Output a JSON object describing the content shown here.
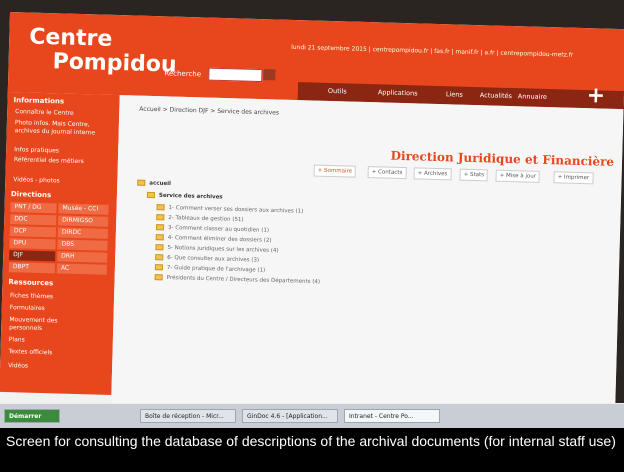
{
  "header": {
    "logo_line1": "Centre",
    "logo_line2": "Pompidou",
    "search_label": "Recherche",
    "date_bar": "lundi 21 septembre 2015 | centrepompidou.fr | fas.fr | manif.fr | a.fr | centrepompidou-metz.fr",
    "nav": [
      "Outils",
      "Applications",
      "Liens",
      "Annuaire",
      "Actualités"
    ]
  },
  "sidebar": {
    "informations_heading": "Informations",
    "info_items": [
      "Connaître le Centre",
      "Photo infos. Mais Centre, archives du journal interne",
      "Infos pratiques",
      "Référentiel des métiers",
      "Vidéos - photos"
    ],
    "directions_heading": "Directions",
    "direction_cells": [
      "PNT / DG",
      "Musée - CCI",
      "DDC",
      "DIRMIGSO",
      "DCP",
      "DIRDC",
      "DPU",
      "DBS",
      "DJF",
      "DRH",
      "DBPT",
      "AC"
    ],
    "ressources_heading": "Ressources",
    "resource_items": [
      "Fiches thèmes",
      "Formulaires",
      "Mouvement des personnels",
      "Plans",
      "Textes officiels",
      "Vidéos"
    ]
  },
  "content": {
    "breadcrumb": "Accueil > Direction DJF > Service des archives",
    "title": "Direction Juridique et Financière",
    "toolbar": [
      "+ Sommaire",
      "+ Contacts",
      "+ Archives",
      "+ Stats",
      "+ Mise à jour",
      "+ Imprimer"
    ],
    "tree_root": "accueil",
    "tree_service": "Service des archives",
    "tree_items": [
      "1- Comment verser ses dossiers aux archives (1)",
      "2- Tableaux de gestion (51)",
      "3- Comment classer au quotidien (1)",
      "4- Comment éliminer des dossiers (2)",
      "5- Notions juridiques sur les archives (4)",
      "6- Que consulter aux archives (3)",
      "7- Guide pratique de l'archivage (1)",
      "Présidents du Centre / Directeurs des Départements (4)"
    ]
  },
  "taskbar": {
    "start_label": "Démarrer",
    "tasks": [
      "Boîte de réception - Micr...",
      "GinDoc 4.6 - [Application...",
      "Intranet - Centre Po..."
    ]
  },
  "caption": "Screen for consulting the database of descriptions of the archival documents (for internal staff use)",
  "colors": {
    "brand": "#e8471e",
    "dark_brand": "#8a2612",
    "caption_bg": "#000000"
  }
}
